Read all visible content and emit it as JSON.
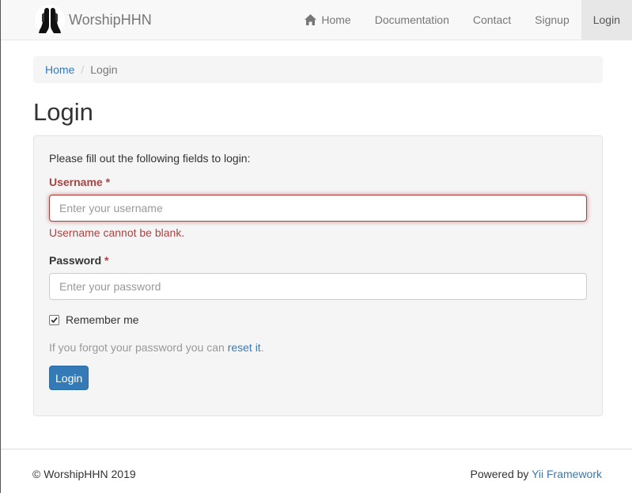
{
  "brand": {
    "name": "WorshipHHN",
    "logo_icon": "praying-hands-icon"
  },
  "nav": {
    "home": "Home",
    "documentation": "Documentation",
    "contact": "Contact",
    "signup": "Signup",
    "login": "Login",
    "active": "login"
  },
  "breadcrumb": {
    "home": "Home",
    "separator": "/",
    "current": "Login"
  },
  "page": {
    "title": "Login"
  },
  "form": {
    "intro": "Please fill out the following fields to login:",
    "username_label": "Username",
    "username_placeholder": "Enter your username",
    "username_value": "",
    "username_error": "Username cannot be blank.",
    "password_label": "Password",
    "password_placeholder": "Enter your password",
    "password_value": "",
    "required_marker": "*",
    "remember_label": "Remember me",
    "remember_checked": true,
    "forgot_text": "If you forgot your password you can",
    "forgot_link": "reset it",
    "forgot_suffix": ".",
    "submit_label": "Login"
  },
  "footer": {
    "copyright": "© WorshipHHN 2019",
    "powered_prefix": "Powered by",
    "powered_link": "Yii Framework"
  },
  "colors": {
    "link": "#337ab7",
    "error": "#a94442",
    "primary_button": "#337ab7",
    "navbar_bg": "#f8f8f8",
    "panel_bg": "#f5f5f5"
  }
}
